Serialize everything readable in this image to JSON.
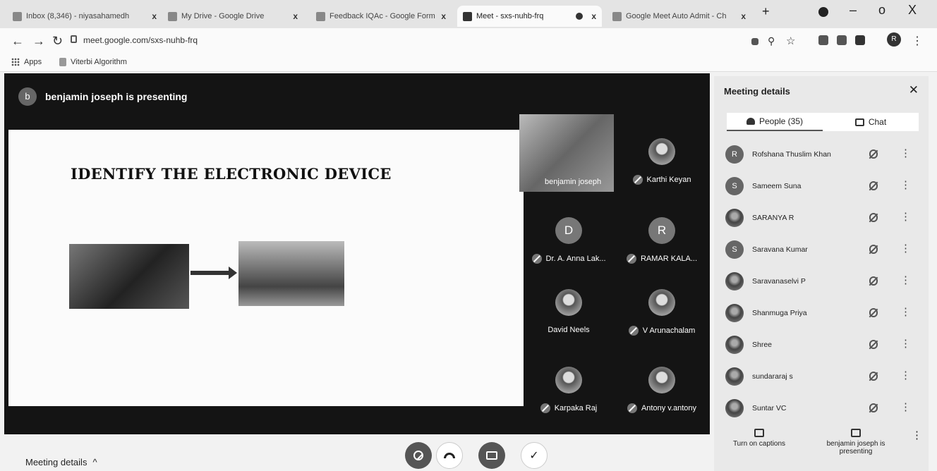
{
  "browser": {
    "tabs": [
      {
        "label": "Inbox (8,346) - niyasahamedh",
        "close": "x"
      },
      {
        "label": "My Drive - Google Drive",
        "close": "x"
      },
      {
        "label": "Feedback IQAc - Google Forms",
        "close": "x"
      },
      {
        "label": "Meet - sxs-nuhb-frq",
        "close": "x"
      },
      {
        "label": "Google Meet Auto Admit - Ch",
        "close": "x"
      }
    ],
    "new_tab": "+",
    "window_controls": {
      "minimize": "–",
      "maximize": "o",
      "close": "X"
    },
    "url": "meet.google.com/sxs-nuhb-frq",
    "profile_initial": "R",
    "bookmarks": [
      "Apps",
      "Viterbi Algorithm"
    ]
  },
  "meet": {
    "presenter_initial": "b",
    "presenting_text": "benjamin joseph is presenting",
    "slide": {
      "title": "IDENTIFY THE ELECTRONIC DEVICE"
    },
    "tiles": [
      {
        "name": "benjamin joseph"
      },
      {
        "name": "Karthi Keyan"
      },
      {
        "name": "Dr. A. Anna Lak...",
        "initial": "D"
      },
      {
        "name": "RAMAR KALA...",
        "initial": "R"
      },
      {
        "name": "David Neels"
      },
      {
        "name": "V Arunachalam"
      },
      {
        "name": "Karpaka Raj"
      },
      {
        "name": "Antony v.antony"
      }
    ],
    "meeting_details_link": "Meeting details",
    "meeting_details_caret": "^"
  },
  "panel": {
    "title": "Meeting details",
    "tab_people": "People (35)",
    "tab_chat": "Chat",
    "participants": [
      {
        "initial": "R",
        "name": "Rofshana Thuslim Khan"
      },
      {
        "initial": "S",
        "name": "Sameem Suna"
      },
      {
        "initial": "",
        "name": "SARANYA R"
      },
      {
        "initial": "S",
        "name": "Saravana Kumar"
      },
      {
        "initial": "",
        "name": "Saravanaselvi P"
      },
      {
        "initial": "",
        "name": "Shanmuga Priya"
      },
      {
        "initial": "",
        "name": "Shree"
      },
      {
        "initial": "",
        "name": "sundararaj s"
      },
      {
        "initial": "",
        "name": "Suntar VC"
      }
    ],
    "captions_label": "Turn on captions",
    "presenting_label": "benjamin joseph is presenting"
  }
}
